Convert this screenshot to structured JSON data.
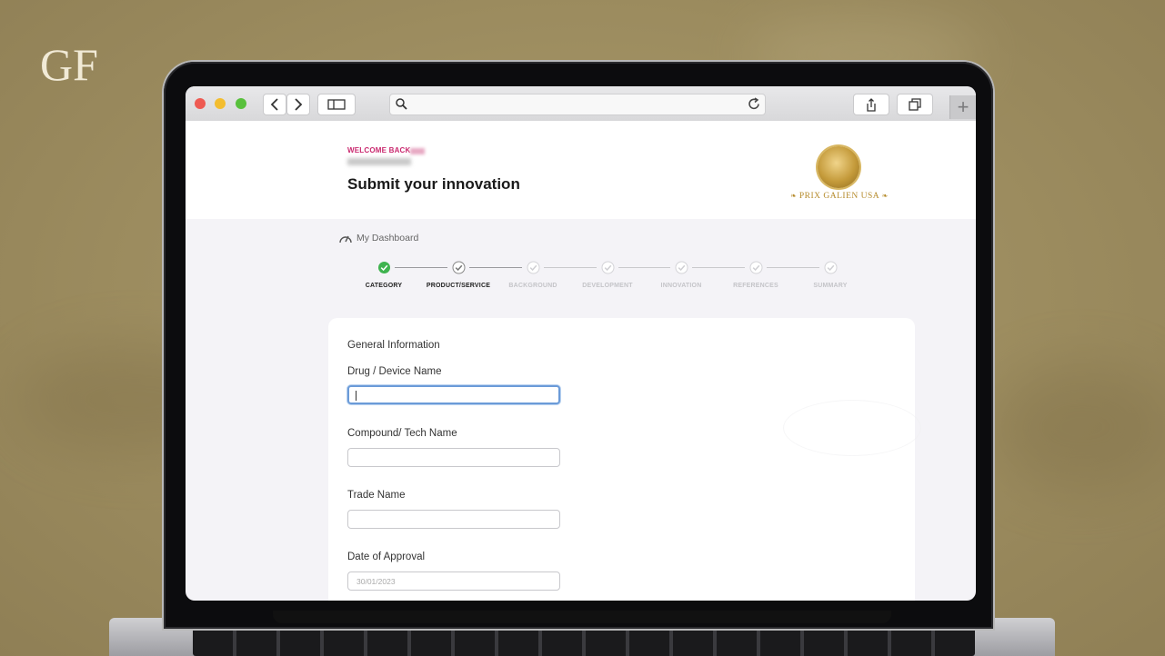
{
  "brand": {
    "logo_text": "GF"
  },
  "browser": {
    "nav_back_icon": "chevron-left-icon",
    "nav_forward_icon": "chevron-right-icon",
    "sidebar_icon": "sidebar-icon",
    "search_icon": "search-icon",
    "reload_icon": "reload-icon",
    "share_icon": "share-icon",
    "tabs_icon": "tabs-icon",
    "new_tab_label": "+"
  },
  "header": {
    "welcome": "WELCOME BACK",
    "title": "Submit your innovation",
    "organization": "PRIX GALIEN USA"
  },
  "dashboard": {
    "label": "My Dashboard"
  },
  "steps": [
    {
      "label": "CATEGORY",
      "state": "complete"
    },
    {
      "label": "PRODUCT/SERVICE",
      "state": "current"
    },
    {
      "label": "BACKGROUND",
      "state": "pending"
    },
    {
      "label": "DEVELOPMENT",
      "state": "pending"
    },
    {
      "label": "INNOVATION",
      "state": "pending"
    },
    {
      "label": "REFERENCES",
      "state": "pending"
    },
    {
      "label": "SUMMARY",
      "state": "pending"
    }
  ],
  "form": {
    "section_title": "General Information",
    "fields": [
      {
        "label": "Drug / Device Name",
        "value": ""
      },
      {
        "label": "Compound/ Tech Name",
        "value": ""
      },
      {
        "label": "Trade Name",
        "value": ""
      },
      {
        "label": "Date of Approval",
        "placeholder": "30/01/2023"
      }
    ]
  },
  "colors": {
    "accent_pink": "#c9286e",
    "complete_green": "#3fb34f",
    "gold": "#b58a2a",
    "focus_blue": "#6b9bd8"
  }
}
